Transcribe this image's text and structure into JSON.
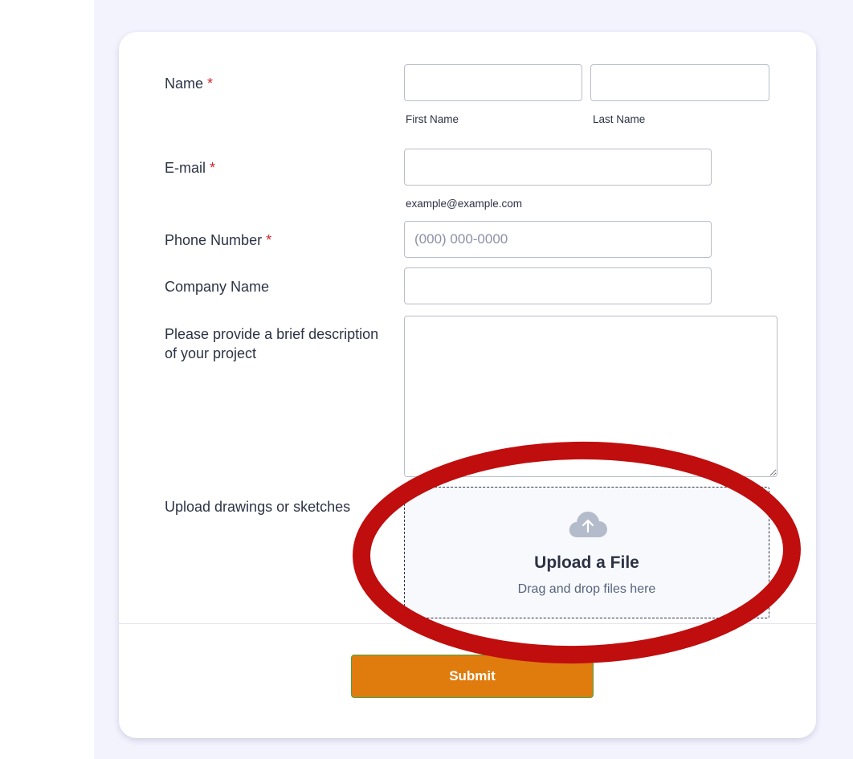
{
  "form": {
    "name": {
      "label": "Name",
      "required_mark": "*",
      "first_sublabel": "First Name",
      "last_sublabel": "Last Name",
      "first_value": "",
      "last_value": ""
    },
    "email": {
      "label": "E-mail",
      "required_mark": "*",
      "sublabel": "example@example.com",
      "value": ""
    },
    "phone": {
      "label": "Phone Number",
      "required_mark": "*",
      "placeholder": "(000) 000-0000",
      "value": ""
    },
    "company": {
      "label": "Company Name",
      "value": ""
    },
    "description": {
      "label": "Please provide a brief description of your project",
      "value": ""
    },
    "upload": {
      "label": "Upload drawings or sketches",
      "title": "Upload a File",
      "subtitle": "Drag and drop files here",
      "icon": "cloud-upload-icon"
    },
    "submit_label": "Submit"
  },
  "colors": {
    "page_background": "#f3f3fe",
    "card_background": "#ffffff",
    "required": "#d4252a",
    "submit_button": "#e07c0e",
    "annotation_ring": "#c00d0d"
  }
}
